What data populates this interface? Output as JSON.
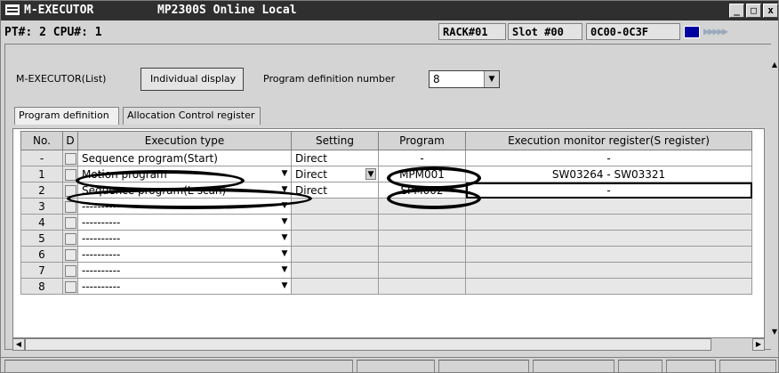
{
  "window": {
    "app_title": "M-EXECUTOR",
    "subtitle": "MP2300S  Online Local",
    "controls": [
      "_",
      "□",
      "x"
    ]
  },
  "status_bar": {
    "pt_cpu": "PT#: 2 CPU#: 1",
    "rack": "RACK#01",
    "slot": "Slot #00",
    "io_range": "0C00-0C3F",
    "led_arrows": "▶▶▶▶▶"
  },
  "toolbar": {
    "mode_label": "M-EXECUTOR(List)",
    "individual_display_button": "Individual display",
    "program_def_number_label": "Program definition number",
    "program_def_number_value": "8"
  },
  "tabs": [
    {
      "label": "Program definition",
      "active": true
    },
    {
      "label": "Allocation Control register",
      "active": false
    }
  ],
  "grid": {
    "columns": [
      "No.",
      "D",
      "Execution type",
      "Setting",
      "Program",
      "Execution monitor register(S register)"
    ],
    "rows": [
      {
        "no": "-",
        "exec": "Sequence program(Start)",
        "setting": "Direct",
        "program": "-",
        "monitor": "-"
      },
      {
        "no": "1",
        "exec": "Motion program",
        "setting": "Direct",
        "program": "MPM001",
        "monitor": "SW03264 - SW03321"
      },
      {
        "no": "2",
        "exec": "Sequence program(L-scan)",
        "setting": "Direct",
        "program": "SPM002",
        "monitor": "-"
      },
      {
        "no": "3",
        "exec": "----------",
        "setting": "",
        "program": "",
        "monitor": ""
      },
      {
        "no": "4",
        "exec": "----------",
        "setting": "",
        "program": "",
        "monitor": ""
      },
      {
        "no": "5",
        "exec": "----------",
        "setting": "",
        "program": "",
        "monitor": ""
      },
      {
        "no": "6",
        "exec": "----------",
        "setting": "",
        "program": "",
        "monitor": ""
      },
      {
        "no": "7",
        "exec": "----------",
        "setting": "",
        "program": "",
        "monitor": ""
      },
      {
        "no": "8",
        "exec": "----------",
        "setting": "",
        "program": "",
        "monitor": ""
      }
    ]
  },
  "colors": {
    "titlebar": "#2f2f2f",
    "panel": "#d4d4d4",
    "annotation_ovals": "#000000"
  }
}
